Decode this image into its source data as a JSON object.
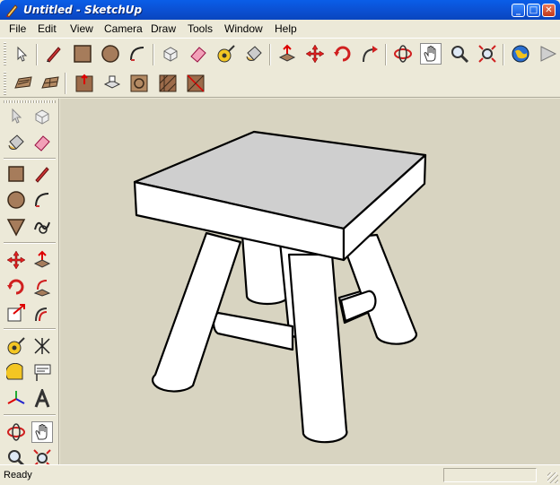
{
  "window": {
    "title": "Untitled - SketchUp",
    "controls": [
      "minimize",
      "maximize",
      "close"
    ],
    "minimize_glyph": "_",
    "maximize_glyph": "□",
    "close_glyph": "✕"
  },
  "menu": {
    "file": "File",
    "edit": "Edit",
    "view": "View",
    "camera": "Camera",
    "draw": "Draw",
    "tools": "Tools",
    "window": "Window",
    "help": "Help"
  },
  "toolbar_main": [
    "select-icon",
    "line-pencil-icon",
    "rectangle-icon",
    "circle-icon",
    "arc-icon",
    "make-component-icon",
    "eraser-icon",
    "tape-measure-icon",
    "paint-bucket-icon",
    "push-pull-icon",
    "move-icon",
    "rotate-icon",
    "follow-me-icon",
    "orbit-icon",
    "pan-hand-icon",
    "zoom-icon",
    "zoom-extents-icon",
    "get-models-icon",
    "share-model-icon"
  ],
  "toolbar_sandbox": [
    "from-contours-icon",
    "from-scratch-icon",
    "smoove-icon",
    "stamp-icon",
    "drape-icon",
    "add-detail-icon",
    "flip-edge-icon"
  ],
  "left_toolbar": [
    "select-icon",
    "make-component-icon",
    "paint-bucket-icon",
    "eraser-icon",
    "rectangle-icon",
    "line-pencil-icon",
    "circle-icon",
    "arc-icon",
    "polygon-icon",
    "freehand-icon",
    "move-icon",
    "push-pull-icon",
    "rotate-icon",
    "follow-me-icon",
    "scale-icon",
    "offset-icon",
    "tape-measure-icon",
    "dimension-icon",
    "protractor-icon",
    "text-icon",
    "axes-icon",
    "3d-text-icon",
    "orbit-icon",
    "pan-hand-icon",
    "zoom-icon",
    "zoom-extents-icon"
  ],
  "colors": {
    "titlebar": "#0b52d6",
    "viewport_bg": "#d8d4c1",
    "model_face": "#ffffff"
  },
  "status": {
    "text": "Ready"
  }
}
